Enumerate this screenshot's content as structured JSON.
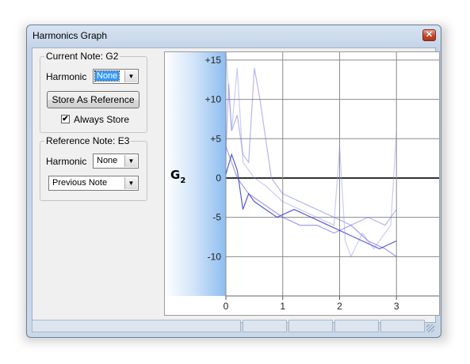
{
  "window": {
    "title": "Harmonics Graph",
    "close_glyph": "✕"
  },
  "current_note": {
    "title": "Current Note: G2",
    "harmonic_label": "Harmonic",
    "harmonic_value": "None",
    "store_button": "Store As Reference",
    "always_store_label": "Always Store",
    "always_store_checked": true
  },
  "reference_note": {
    "title": "Reference Note: E3",
    "harmonic_label": "Harmonic",
    "harmonic_value": "None",
    "mode_value": "Previous Note"
  },
  "graph": {
    "note_letter": "G",
    "note_octave": "2"
  },
  "chart_data": {
    "type": "line",
    "xlim": [
      0,
      3.75
    ],
    "ylim": [
      -15,
      16
    ],
    "x_ticks": [
      "0",
      "1",
      "2",
      "3"
    ],
    "y_ticks": [
      "+15",
      "+10",
      "+5",
      "0",
      "-5",
      "-10"
    ],
    "grid": true,
    "series": [
      {
        "x": [
          0,
          0.1,
          0.2,
          0.3,
          0.4,
          0.5,
          0.7,
          0.9,
          1.2,
          1.5,
          1.8,
          2.1,
          2.4,
          2.7,
          3.0
        ],
        "y": [
          0.5,
          3,
          1,
          -4,
          -2,
          -3,
          -4,
          -5,
          -4,
          -5,
          -6,
          -7,
          -8,
          -9,
          -8
        ]
      },
      {
        "x": [
          0,
          0.1,
          0.2,
          0.3,
          0.4,
          0.6,
          0.8,
          1.0,
          1.3,
          1.6,
          1.9,
          2.2,
          2.5,
          2.8,
          3.0
        ],
        "y": [
          4,
          2,
          0,
          -1,
          -2,
          -3,
          -4,
          -5,
          -6,
          -6,
          -7,
          -6,
          -8,
          -9,
          -10
        ]
      },
      {
        "x": [
          0,
          0.05,
          0.1,
          0.2,
          0.3,
          0.4,
          0.5,
          0.6,
          0.8,
          1.0,
          1.3,
          1.6,
          1.9,
          2.2,
          2.5,
          2.8,
          3.0
        ],
        "y": [
          3,
          12,
          6,
          8,
          3,
          2,
          14,
          10,
          0,
          -2,
          -3,
          -4,
          -5,
          -6,
          -5,
          -6,
          -4
        ]
      },
      {
        "x": [
          0,
          0.1,
          0.2,
          0.3,
          0.5,
          0.7,
          1.0,
          1.3,
          1.6,
          1.9,
          2.0,
          2.1,
          2.2,
          2.4,
          2.6,
          2.9,
          3.0
        ],
        "y": [
          16,
          6,
          14,
          2,
          0,
          -1,
          -3,
          -4,
          -5,
          -6,
          4,
          -8,
          -10,
          -7,
          -9,
          -6,
          6
        ]
      }
    ]
  }
}
